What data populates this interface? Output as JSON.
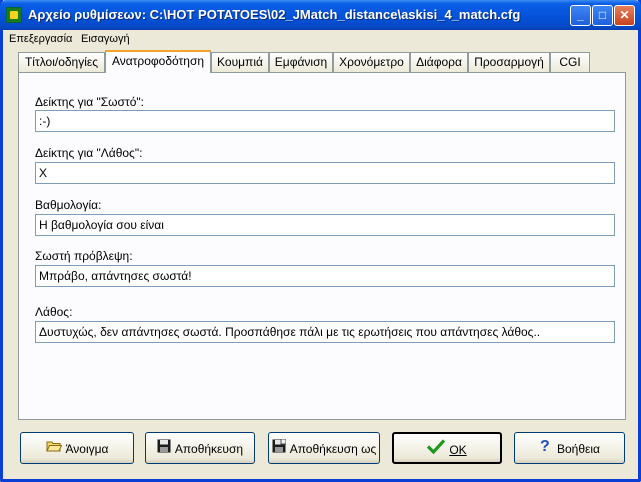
{
  "window": {
    "title": "Αρχείο ρυθμίσεων:  C:\\HOT POTATOES\\02_JMatch_distance\\askisi_4_match.cfg"
  },
  "menu": {
    "items": [
      "Επεξεργασία",
      "Εισαγωγή"
    ]
  },
  "tabs": [
    "Τίτλοι/οδηγίες",
    "Ανατροφοδότηση",
    "Κουμπιά",
    "Εμφάνιση",
    "Χρονόμετρο",
    "Διάφορα",
    "Προσαρμογή",
    "CGI"
  ],
  "active_tab": "Ανατροφοδότηση",
  "fields": [
    {
      "label": "Δείκτης για \"Σωστό\":",
      "value": ":-)"
    },
    {
      "label": "Δείκτης για \"Λάθος\":",
      "value": "X"
    },
    {
      "label": "Βαθμολογία:",
      "value": "Η βαθμολογία σου είναι"
    },
    {
      "label": "Σωστή πρόβλεψη:",
      "value": "Μπράβο, απάντησες σωστά!"
    },
    {
      "label": "Λάθος:",
      "value": "Δυστυχώς, δεν απάντησες σωστά. Προσπάθησε πάλι με τις ερωτήσεις που απάντησες λάθος.."
    }
  ],
  "buttons": {
    "open": "Άνοιγμα",
    "save": "Αποθήκευση",
    "save_as": "Αποθήκευση ως",
    "ok": "OK",
    "help": "Βοήθεια"
  },
  "icons": {
    "open": "folder-open-icon",
    "save": "floppy-disk-icon",
    "save_as": "floppy-disk-as-icon",
    "ok": "green-checkmark-icon",
    "help": "help-question-icon"
  },
  "colors": {
    "titlebar": "#0554dc",
    "active_tab_accent": "#f4a32a",
    "ok_check": "#1e9a1e",
    "help_icon": "#1f4fb8"
  }
}
